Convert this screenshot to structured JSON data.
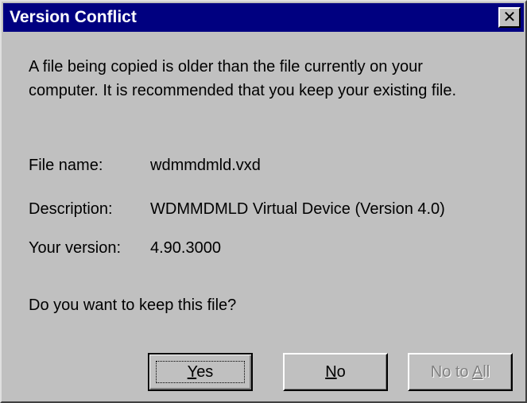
{
  "window": {
    "title": "Version Conflict",
    "close_glyph": "✕",
    "close_icon": "close-icon"
  },
  "message": {
    "line1": "A file being copied is older than the file currently on your",
    "line2": "computer. It is recommended that you keep your existing file."
  },
  "details": {
    "file_name_label": "File name:",
    "file_name_value": "wdmmdmld.vxd",
    "description_label": "Description:",
    "description_value": "WDMMDMLD Virtual Device  (Version 4.0)",
    "version_label": "Your version:",
    "version_value": "4.90.3000"
  },
  "prompt": "Do you want to keep this file?",
  "buttons": {
    "yes": {
      "accel": "Y",
      "rest": "es"
    },
    "no": {
      "accel": "N",
      "rest": "o"
    },
    "no_to_all": {
      "prefix": "No to ",
      "accel": "A",
      "rest": "ll"
    }
  },
  "colors": {
    "titlebar": "#000080",
    "face": "#c0c0c0",
    "disabled_text": "#808080"
  }
}
